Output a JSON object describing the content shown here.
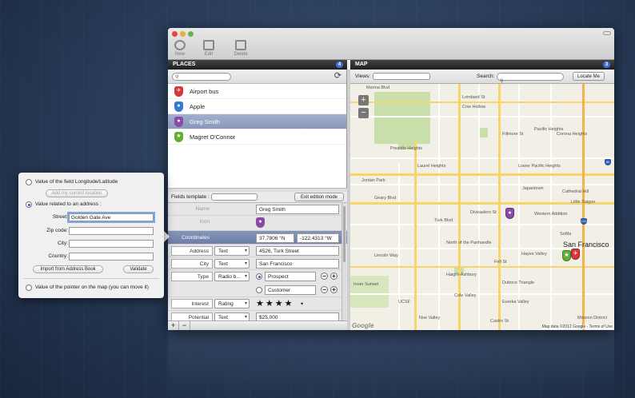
{
  "toolbar": {
    "new_label": "New",
    "edit_label": "Edit",
    "delete_label": "Delete"
  },
  "places": {
    "header": "PLACES",
    "count": "4",
    "items": [
      {
        "name": "Airport bus",
        "color": "#d6363c"
      },
      {
        "name": "Apple",
        "color": "#3b78d6"
      },
      {
        "name": "Greg Smith",
        "color": "#8a4aa8"
      },
      {
        "name": "Magret O'Connor",
        "color": "#5fb033"
      }
    ]
  },
  "fields_template": {
    "label": "Fields template :",
    "exit_button": "Exit edition mode"
  },
  "form": {
    "name_label": "Name",
    "name_value": "Greg Smith",
    "icon_label": "Icon",
    "coordinates_label": "Coordinates",
    "lat": "37,7806 °N",
    "lon": "-122,4313 °W",
    "address_label": "Address",
    "address_type": "Text",
    "address_value": "4526, Turk Street",
    "city_label": "City",
    "city_type": "Text",
    "city_value": "San Francisco",
    "type_label": "Type",
    "type_type": "Radio b...",
    "type_option1": "Prospect",
    "type_option2": "Customer",
    "interest_label": "Interest",
    "interest_type": "Rating",
    "interest_stars": "★★★★",
    "potential_label": "Potential",
    "potential_type": "Text",
    "potential_value": "$25,000"
  },
  "map": {
    "header": "MAP",
    "count": "3",
    "views_label": "Views:",
    "search_label": "Search:",
    "locate_button": "Locate Me",
    "attribution": "Map data ©2012 Google - Terms of Use",
    "google_logo": "Google",
    "labels": {
      "lombard": "Lombard St",
      "corona": "Corona Heights",
      "pacific": "Pacific Heights",
      "lower_pacific": "Lower Pacific Heights",
      "western": "Western Addition",
      "turk": "Turk Blvd",
      "fell": "Fell St",
      "haight": "Haight-Ashbury",
      "cole": "Cole Valley",
      "castro": "Castro St",
      "noe": "Noe Valley",
      "mission": "Mission District",
      "soma": "SoMa",
      "sf": "San Francisco",
      "marina": "Marina Blvd",
      "geary": "Geary Blvd",
      "divisadero": "Divisadero St",
      "fillmore": "Fillmore St",
      "lincoln": "Lincoln Way",
      "duboce": "Duboce Triangle",
      "jordan": "Jordan Park",
      "presidio": "Presidio Heights",
      "laurel": "Laurel Heights",
      "cowhollow": "Cow Hollow",
      "japantown": "Japantown",
      "hayes": "Hayes Valley",
      "inner_sunset": "Inner Sunset",
      "panhandle": "North of the Panhandle",
      "cathedral": "Cathedral Hill",
      "little_saigon": "Little Saigon",
      "eureka": "Eureka Valley",
      "ucsf": "UCSF",
      "fwy": "101",
      "fwy2": "80"
    }
  },
  "popup": {
    "option_longlat": "Value of the field Longitude/Latitude",
    "add_location_button": "Add my current location",
    "option_address": "Value related to an address :",
    "street_label": "Street:",
    "street_value": "Golden Gate Ave",
    "zip_label": "Zip code:",
    "city_label": "City:",
    "country_label": "Country:",
    "import_button": "Import from Address Book",
    "validate_button": "Validate",
    "option_pointer": "Value of the pointer on the map (you can move it)"
  }
}
